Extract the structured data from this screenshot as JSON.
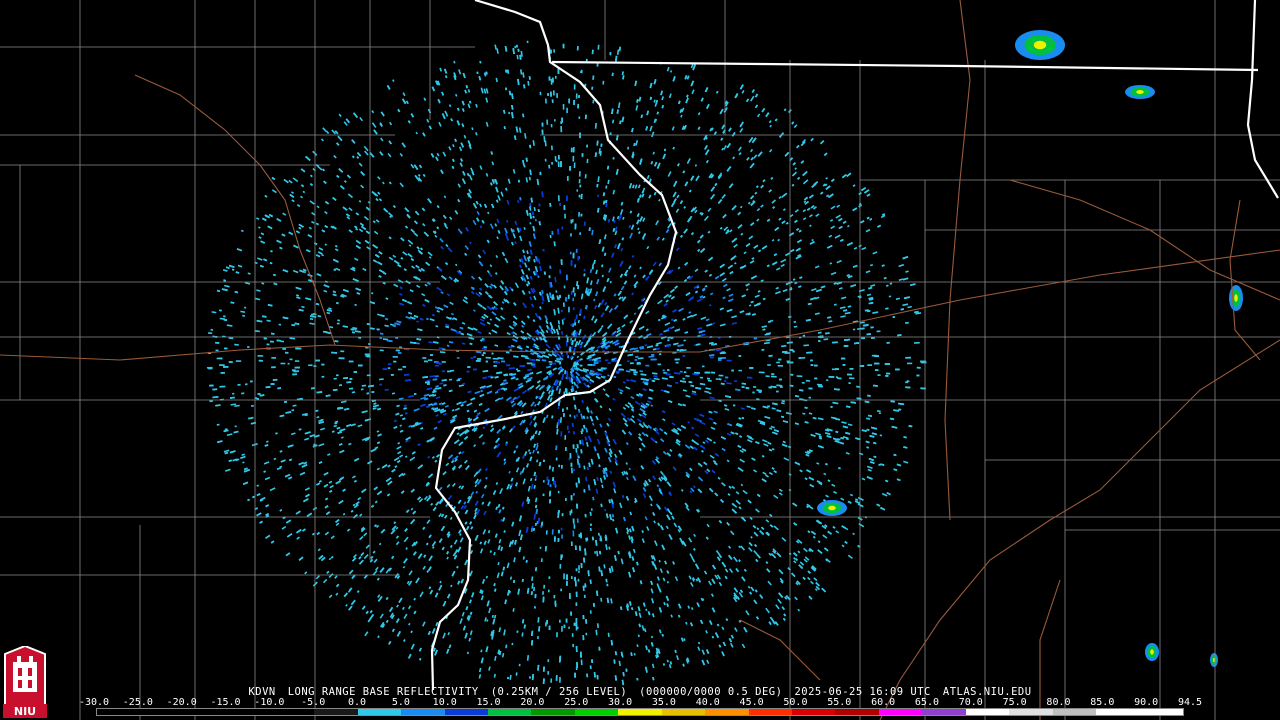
{
  "caption": {
    "station": "KDVN",
    "product": "LONG RANGE BASE REFLECTIVITY",
    "resolution": "(0.25KM / 256 LEVEL)",
    "sweep": "(000000/0000 0.5 DEG)",
    "timestamp": "2025-06-25 16:09 UTC",
    "source": "ATLAS.NIU.EDU"
  },
  "scale": {
    "ticks": [
      "-30.0",
      "-25.0",
      "-20.0",
      "-15.0",
      "-10.0",
      "-5.0",
      "0.0",
      "5.0",
      "10.0",
      "15.0",
      "20.0",
      "25.0",
      "30.0",
      "35.0",
      "40.0",
      "45.0",
      "50.0",
      "55.0",
      "60.0",
      "65.0",
      "70.0",
      "75.0",
      "80.0",
      "85.0",
      "90.0",
      "94.5"
    ],
    "colors": [
      "#000000",
      "#000000",
      "#000000",
      "#000000",
      "#000000",
      "#1a1a1a",
      "#30c8e8",
      "#1a8cf0",
      "#0a3cd8",
      "#00c040",
      "#009a00",
      "#00d000",
      "#f0f000",
      "#e8c000",
      "#ff9000",
      "#ff3000",
      "#d80000",
      "#b00000",
      "#ff00ff",
      "#9040d0",
      "#ffffff",
      "#e0e0e0",
      "#c0c0c0",
      "#ffffff",
      "#ffffff"
    ]
  },
  "logo": {
    "text": "NIU"
  },
  "colors": {
    "background": "#000000",
    "county_lines": "#8a8a8a",
    "roads": "#9a5a3a",
    "state_lines": "#ffffff",
    "echo_light": "#30c8e8",
    "echo_mid": "#1a8cf0",
    "echo_dark": "#0a3cd8"
  }
}
